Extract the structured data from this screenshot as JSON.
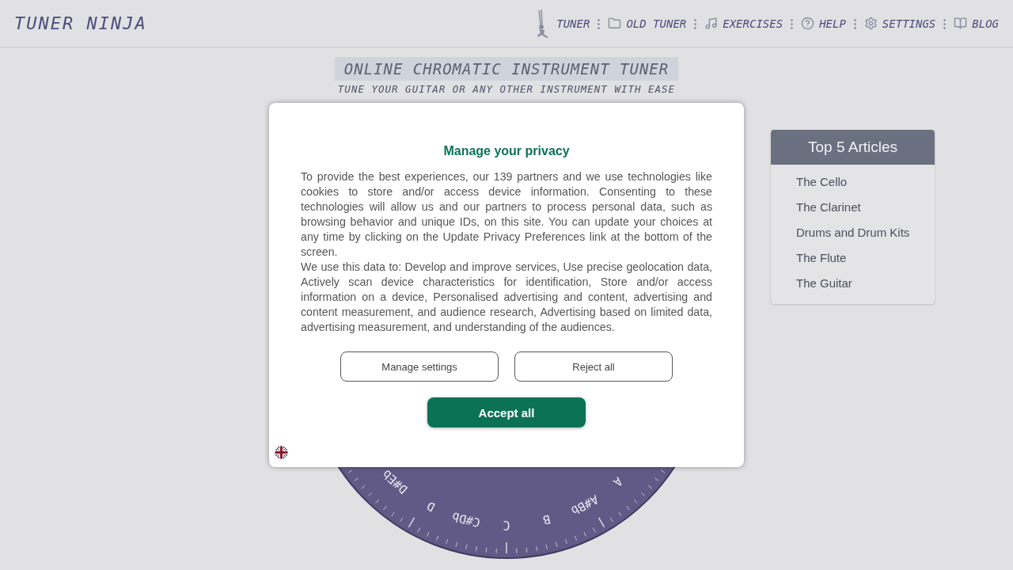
{
  "brand": "TUNER NINJA",
  "nav": [
    {
      "label": "TUNER"
    },
    {
      "label": "OLD TUNER"
    },
    {
      "label": "EXERCISES"
    },
    {
      "label": "HELP"
    },
    {
      "label": "SETTINGS"
    },
    {
      "label": "BLOG"
    }
  ],
  "headline": "ONLINE CHROMATIC INSTRUMENT TUNER",
  "subheadline": "TUNE YOUR GUITAR OR ANY OTHER INSTRUMENT WITH EASE",
  "dial_notes": [
    "D#Eb",
    "D",
    "C#Db",
    "C",
    "B",
    "A#Bb",
    "A"
  ],
  "articles": {
    "title": "Top 5 Articles",
    "items": [
      "The Cello",
      "The Clarinet",
      "Drums and Drum Kits",
      "The Flute",
      "The Guitar"
    ]
  },
  "consent": {
    "title": "Manage your privacy",
    "paragraphs": [
      "To provide the best experiences, our 139 partners and we use technologies like cookies to store and/or access device information. Consenting to these technologies will allow us and our partners to process personal data, such as browsing behavior and unique IDs, on this site. You can update your choices at any time by clicking on the Update Privacy Preferences link at the bottom of the screen.",
      "We use this data to: Develop and improve services, Use precise geolocation data, Actively scan device characteristics for identification, Store and/or access information on a device, Personalised advertising and content, advertising and content measurement, and audience research, Advertising based on limited data, advertising measurement, and understanding of the audiences."
    ],
    "buttons": [
      {
        "label": "Manage settings",
        "kind": "outline"
      },
      {
        "label": "Reject all",
        "kind": "outline"
      }
    ],
    "accept": "Accept all"
  }
}
